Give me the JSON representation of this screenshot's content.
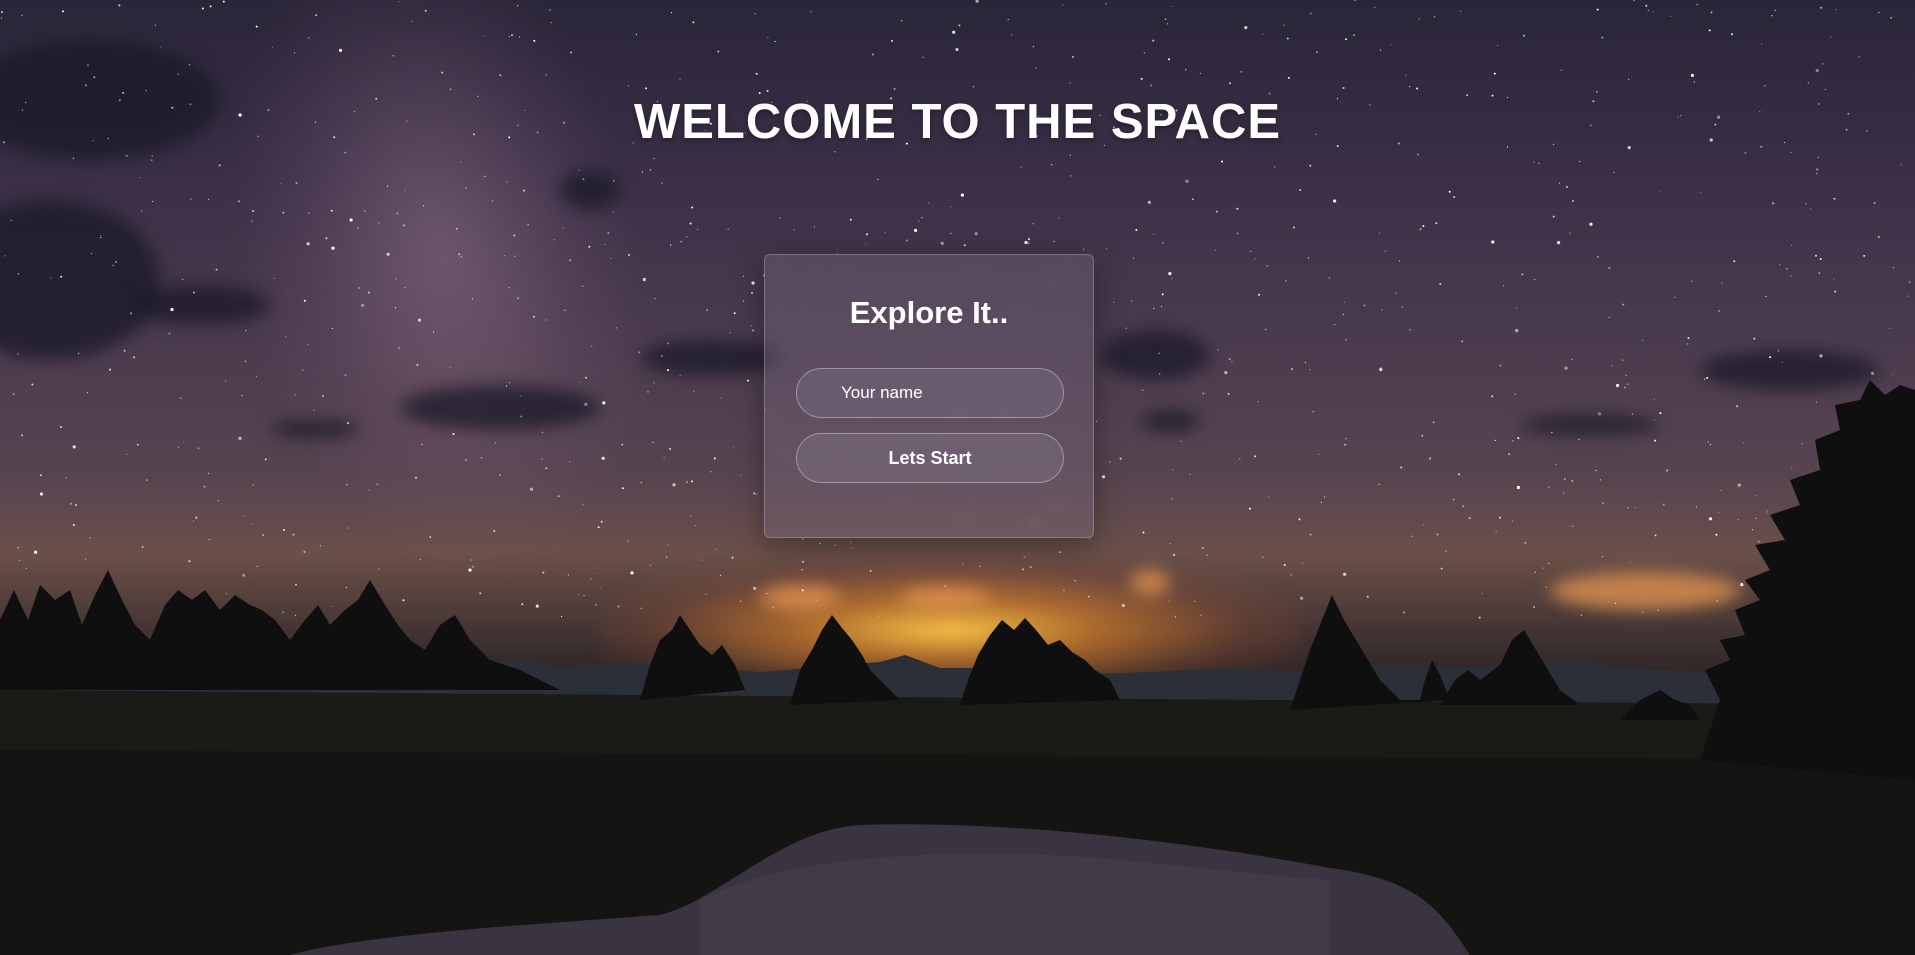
{
  "page": {
    "title": "WELCOME TO THE SPACE"
  },
  "card": {
    "title": "Explore It..",
    "name_input": {
      "placeholder": "Your name",
      "value": ""
    },
    "start_button_label": "Lets Start"
  },
  "background": {
    "scene": "starry-night-sky-landscape",
    "colors": {
      "sky_top": "#2a2538",
      "horizon_glow": "#ffc846",
      "ground": "#121211"
    }
  }
}
